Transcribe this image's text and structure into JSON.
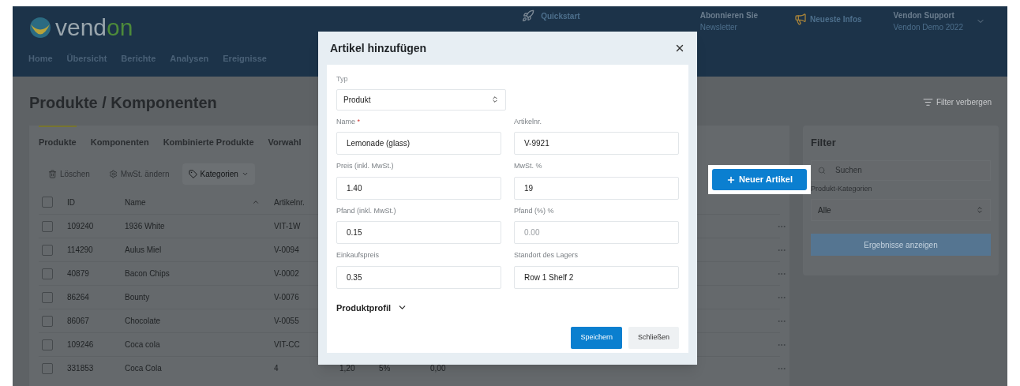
{
  "header": {
    "logo": {
      "part_a": "vend",
      "part_b": "on"
    },
    "nav": [
      {
        "label": "Home"
      },
      {
        "label": "Übersicht"
      },
      {
        "label": "Berichte"
      },
      {
        "label": "Analysen"
      },
      {
        "label": "Ereignisse"
      }
    ],
    "quickstart": "Quickstart",
    "newsletter": {
      "line_1": "Abonnieren Sie",
      "line_2": "Newsletter"
    },
    "news": "Neueste Infos",
    "account": {
      "name": "Vendon Support",
      "org": "Vendon Demo 2022"
    }
  },
  "page": {
    "title": "Produkte / Komponenten",
    "filter_toggle": "Filter verbergen"
  },
  "tabs": [
    {
      "label": "Produkte",
      "selected": true
    },
    {
      "label": "Komponenten",
      "selected": false
    },
    {
      "label": "Kombinierte Produkte",
      "selected": false
    },
    {
      "label": "Vorwahl",
      "selected": false
    }
  ],
  "toolbar": [
    {
      "label": "Löschen",
      "kind": "trash",
      "disabled": true
    },
    {
      "label": "MwSt. ändern",
      "kind": "gear",
      "disabled": true
    },
    {
      "label": "Kategorien",
      "kind": "tag",
      "disabled": false
    }
  ],
  "table": {
    "columns": [
      "ID",
      "Name",
      "Artikelnr."
    ],
    "header_checked": false,
    "rows": [
      {
        "checked": false,
        "cells": [
          "109240",
          "1936 White",
          "VIT-1W"
        ]
      },
      {
        "checked": false,
        "cells": [
          "114290",
          "Aulus Miel",
          "V-0094"
        ]
      },
      {
        "checked": false,
        "cells": [
          "40879",
          "Bacon Chips",
          "V-0002"
        ]
      },
      {
        "checked": false,
        "cells": [
          "86264",
          "Bounty",
          "V-0076"
        ]
      },
      {
        "checked": false,
        "cells": [
          "86067",
          "Chocolate",
          "V-0055"
        ]
      },
      {
        "checked": false,
        "cells": [
          "109246",
          "Coca cola",
          "VIT-CC"
        ]
      },
      {
        "checked": false,
        "cells": [
          "331853",
          "Coca Cola",
          "4",
          "1,20",
          "5%",
          "0,00"
        ]
      }
    ]
  },
  "new_item_button": "Neuer Artikel",
  "filter": {
    "title": "Filter",
    "search_placeholder": "Suchen",
    "category_label": "Produkt-Kategorien",
    "category_value": "Alle",
    "apply_button": "Ergebnisse anzeigen"
  },
  "dialog": {
    "title": "Artikel hinzufügen",
    "type_label": "Typ",
    "type_value": "Produkt",
    "required_mark": "*",
    "fields": [
      {
        "label": "Name",
        "required": true,
        "value": "Lemonade (glass)"
      },
      {
        "label": "Artikelnr.",
        "required": false,
        "value": "V-9921"
      },
      {
        "label": "Preis (inkl. MwSt.)",
        "required": false,
        "value": "1.40"
      },
      {
        "label": "MwSt. %",
        "required": false,
        "value": "19"
      },
      {
        "label": "Pfand (inkl. MwSt.)",
        "required": false,
        "value": "0.15"
      },
      {
        "label": "Pfand (%) %",
        "required": false,
        "placeholder": "0.00"
      },
      {
        "label": "Einkaufspreis",
        "required": false,
        "value": "0.35"
      },
      {
        "label": "Standort des Lagers",
        "required": false,
        "value": "Row 1 Shelf 2"
      }
    ],
    "section": "Produktprofil",
    "expanded": false,
    "save_button": "Speichern",
    "close_button": "Schließen"
  }
}
